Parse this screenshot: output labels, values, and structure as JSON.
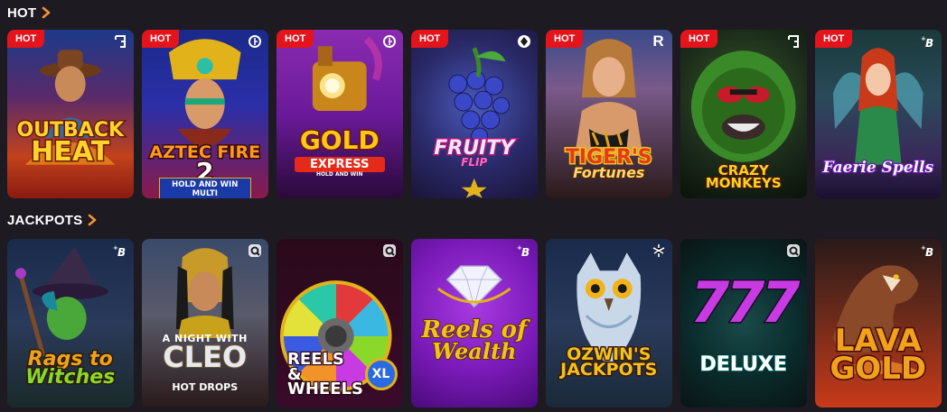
{
  "sections": {
    "hot": {
      "title": "HOT"
    },
    "jackpots": {
      "title": "JACKPOTS"
    }
  },
  "hot_games": [
    {
      "title_lines": [
        "OUTBACK",
        "HEAT"
      ],
      "badge": "HOT",
      "provider_icon": "g-bracket-icon",
      "provider_glyph": "⌐"
    },
    {
      "title_lines": [
        "AZTEC FIRE",
        "2"
      ],
      "subtitle": "HOLD AND WIN  MULTI",
      "badge": "HOT",
      "provider_icon": "b-circle-icon",
      "provider_glyph": "◔"
    },
    {
      "title_lines": [
        "GOLD",
        "EXPRESS"
      ],
      "subtitle": "HOLD AND WIN",
      "badge": "HOT",
      "provider_icon": "b-circle-icon",
      "provider_glyph": "◔"
    },
    {
      "title_lines": [
        "FRUITY",
        "FLIP"
      ],
      "badge": "HOT",
      "provider_icon": "diamond-circle-icon",
      "provider_glyph": "◈"
    },
    {
      "title_lines": [
        "TIGER'S",
        "Fortunes"
      ],
      "badge": "HOT",
      "provider_icon": "r-logo-icon",
      "provider_glyph": "R"
    },
    {
      "title_lines": [
        "CRAZY MONKEYS"
      ],
      "badge": "HOT",
      "provider_icon": "g-bracket-icon",
      "provider_glyph": "⌐"
    },
    {
      "title_lines": [
        "Faerie Spells"
      ],
      "badge": "HOT",
      "provider_icon": "b-plus-icon",
      "provider_glyph": "ᵖB"
    }
  ],
  "jackpot_games": [
    {
      "title_lines": [
        "Rags to",
        "Witches"
      ],
      "provider_icon": "b-plus-icon",
      "provider_glyph": "ᵖB"
    },
    {
      "title_lines": [
        "A NIGHT WITH",
        "CLEO"
      ],
      "subtitle": "HOT DROPS",
      "provider_icon": "q-logo-icon",
      "provider_glyph": "Q"
    },
    {
      "title_lines": [
        "REELS &",
        "WHEELS"
      ],
      "subtitle": "XL",
      "provider_icon": "q-logo-icon",
      "provider_glyph": "Q"
    },
    {
      "title_lines": [
        "Reels of",
        "Wealth"
      ],
      "provider_icon": "b-plus-icon",
      "provider_glyph": "ᵖB"
    },
    {
      "title_lines": [
        "OZWIN'S",
        "JACKPOTS"
      ],
      "provider_icon": "leaf-logo-icon",
      "provider_glyph": "✲"
    },
    {
      "title_lines": [
        "777",
        "DELUXE"
      ],
      "provider_icon": "q-logo-icon",
      "provider_glyph": "Q"
    },
    {
      "title_lines": [
        "LAVA",
        "GOLD"
      ],
      "provider_icon": "b-plus-icon",
      "provider_glyph": "ᵖB"
    }
  ],
  "colors": {
    "background": "#1e1a22",
    "hot_badge": "#e3141c",
    "chevron": "#f2933a"
  }
}
